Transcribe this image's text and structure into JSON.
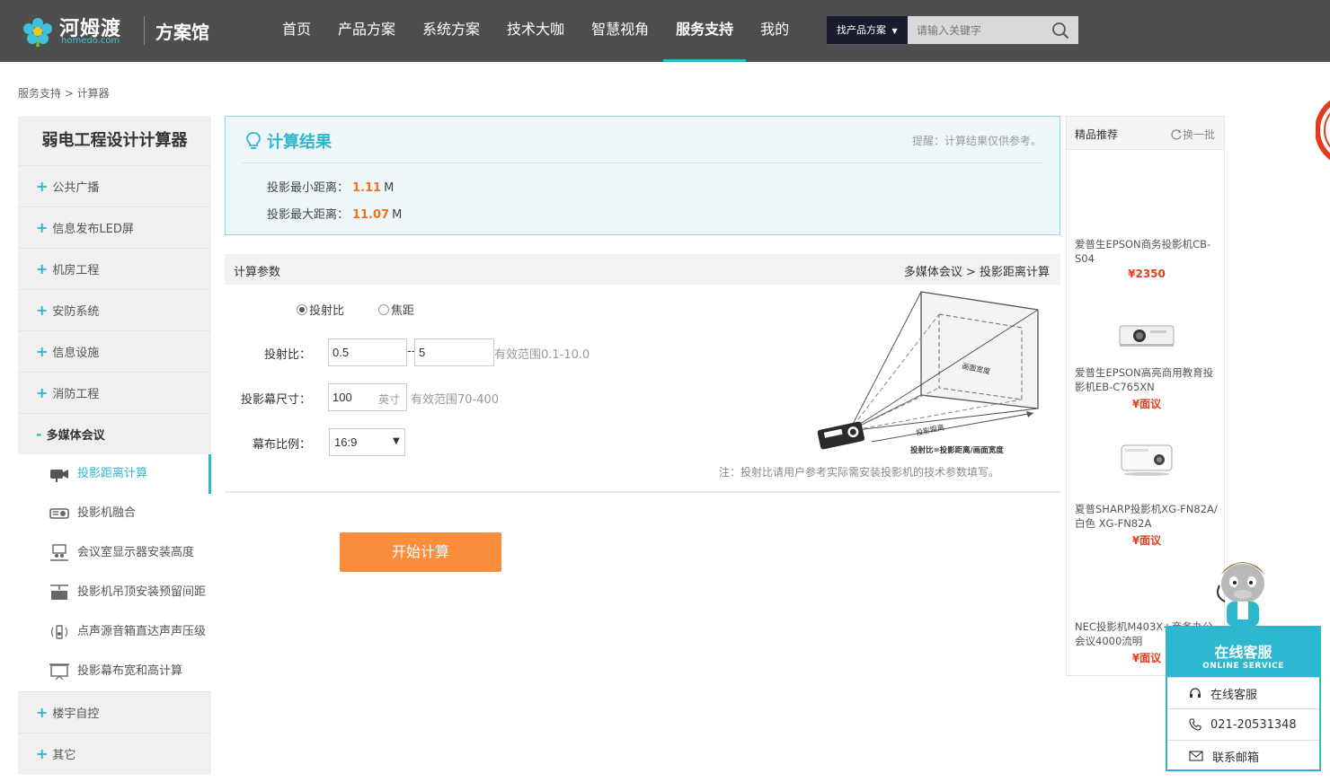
{
  "header": {
    "logo_text": "河姆渡",
    "logo_sub": "homedo.com",
    "site_name": "方案馆",
    "nav": [
      "首页",
      "产品方案",
      "系统方案",
      "技术大咖",
      "智慧视角",
      "服务支持",
      "我的"
    ],
    "active_nav": "服务支持",
    "search_type": "找产品方案",
    "search_placeholder": "请输入关键字"
  },
  "breadcrumb": "服务支持 > 计算器",
  "sidebar": {
    "title": "弱电工程设计计算器",
    "items": [
      "公共广播",
      "信息发布LED屏",
      "机房工程",
      "安防系统",
      "信息设施",
      "消防工程"
    ],
    "open_item": "多媒体会议",
    "sub_items": [
      "投影距离计算",
      "投影机融合",
      "会议室显示器安装高度",
      "投影机吊顶安装预留间距",
      "点声源音箱直达声声压级",
      "投影幕布宽和高计算"
    ],
    "after_items": [
      "楼宇自控",
      "其它"
    ],
    "plus": "+",
    "minus": "-"
  },
  "result": {
    "title": "计算结果",
    "tip": "提醒：计算结果仅供参考。",
    "min_label": "投影最小距离：",
    "min_value": "1.11",
    "max_label": "投影最大距离：",
    "max_value": "11.07",
    "unit": "M"
  },
  "params": {
    "title": "计算参数",
    "path": "多媒体会议 > 投影距离计算",
    "radio_ratio": "投射比",
    "radio_focal": "焦距",
    "ratio_label": "投射比：",
    "ratio_min": "0.5",
    "ratio_sep": "--",
    "ratio_max": "5",
    "ratio_hint": "有效范围0.1-10.0",
    "screen_label": "投影幕尺寸：",
    "screen_value": "100",
    "screen_unit": "英寸",
    "screen_hint": "有效范围70-400",
    "aspect_label": "幕布比例：",
    "aspect_value": "16:9",
    "diagram_width_label": "画面宽度",
    "diagram_distance_label": "投影距离",
    "diagram_formula": "投射比=投影距离/画面宽度",
    "note": "注：投射比请用户参考实际需安装投影机的技术参数填写。",
    "button": "开始计算"
  },
  "recommend": {
    "title": "精品推荐",
    "refresh": "换一批",
    "items": [
      {
        "name": "爱普生EPSON商务投影机CB-S04",
        "price": "¥2350"
      },
      {
        "name": "爱普生EPSON高亮商用教育投影机EB-C765XN",
        "price": "¥面议"
      },
      {
        "name": "夏普SHARP投影机XG-FN82A/白色 XG-FN82A",
        "price": "¥面议"
      },
      {
        "name": "NEC投影机M403X+商务办公会议4000流明",
        "price": "¥面议"
      }
    ]
  },
  "service": {
    "title_cn": "在线客服",
    "title_en": "ONLINE SERVICE",
    "online": "在线客服",
    "phone": "021-20531348",
    "email": "联系邮箱"
  },
  "colors": {
    "accent": "#2eb8cf",
    "orange": "#fb8e3c",
    "header_bg": "#4e4e4e",
    "price": "#e53c1d"
  }
}
